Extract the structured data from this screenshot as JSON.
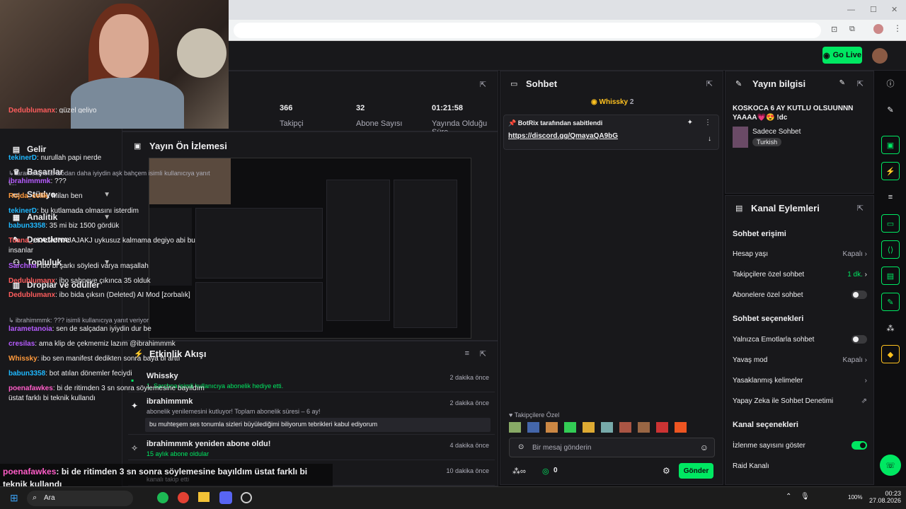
{
  "browser": {
    "search_label": "Ara"
  },
  "header": {
    "go_live": "Go Live"
  },
  "nav": [
    "Gelir",
    "Başarılar",
    "Stüdyo",
    "Analitik",
    "Denetleme",
    "Topluluk",
    "Droplar ve ödüller"
  ],
  "stats": [
    {
      "value": "366",
      "label": "Takipçi"
    },
    {
      "value": "32",
      "label": "Abone Sayısı"
    },
    {
      "value": "01:21:58",
      "label": "Yayında Olduğu Süre"
    }
  ],
  "preview": {
    "title": "Yayın Ön İzlemesi"
  },
  "activity": {
    "title": "Etkinlik Akışı",
    "items": [
      {
        "name": "Whissky",
        "sub": "1, Sarchna isimli kullanıcıya abonelik hediye etti.",
        "time": "2 dakika önce"
      },
      {
        "name": "ibrahimmmk",
        "sub": "abonelik yenilemesini kutluyor! Toplam abonelik süresi – 6 ay!",
        "quote": "bu muhteşem ses tonumla sizleri büyülediğimi biliyorum tebrikleri kabul ediyorum",
        "time": "2 dakika önce"
      },
      {
        "name": "ibrahimmmk yeniden abone oldu!",
        "sub": "15 aylık abone oldular",
        "time": "4 dakika önce"
      },
      {
        "name": "",
        "sub": "kanalı takip etti",
        "time": "10 dakika önce"
      }
    ]
  },
  "chat": {
    "title": "Sohbet",
    "top_user": "Whissky",
    "top_count": "2",
    "pinned_by": "BotRix tarafından sabitlendi",
    "pinned_link": "https://discord.gg/QmayaQA9bG",
    "messages": [
      {
        "user": "Dedublumanx",
        "text": ": güzel geliyo",
        "color": "#ff5d5d"
      },
      {
        "user": "tekinerD",
        "text": ": nurullah papi nerde",
        "color": "#1fb8ff"
      },
      {
        "user": "",
        "text": "↳ larametanoia: ibodan daha iyiydin aşk bahçem isimli kullanıcıya yanıt v...",
        "color": "#adadb8",
        "reply": true
      },
      {
        "user": "ibrahimmmk",
        "text": ": ???",
        "color": "#b65cff"
      },
      {
        "user": "Rojda_celik",
        "text": ": Milan ben",
        "color": "#ff9a3c"
      },
      {
        "user": "tekinerD",
        "text": ": bu kutlamada olmasını isterdim",
        "color": "#1fb8ff"
      },
      {
        "user": "babun3358",
        "text": ": 35 mi biz 1500 gördük",
        "color": "#1fb8ff"
      },
      {
        "user": "Tuana_",
        "text": ": KAJAJNAJAJAKJ uykusuz kalmama degiyo abi bu insanlar",
        "color": "#ff5d5d"
      },
      {
        "user": "Sarchna",
        "text": ": İbo bi şarkı söyledi varya maşallah",
        "color": "#b65cff"
      },
      {
        "user": "Dedublumanx",
        "text": ": ibo sahneye çıkınca 35 olduk",
        "color": "#ff5d5d"
      },
      {
        "user": "Dedublumanx",
        "text": ": ibo bida çıksın (Deleted) AI Mod [zorbalık]",
        "color": "#ff5d5d"
      },
      {
        "user": "",
        "text": "↳ ibrahimmmk: ??? isimli kullanıcıya yanıt veriyor",
        "color": "#adadb8",
        "reply": true
      },
      {
        "user": "larametanoia",
        "text": ": sen de salçadan iyiydin dur be",
        "color": "#b65cff"
      },
      {
        "user": "cresilas",
        "text": ": ama klip de çekmemiz lazım @ibrahimmmk",
        "color": "#b65cff"
      },
      {
        "user": "Whissky",
        "text": ": ibo sen manifest dedikten sonra baya bi arttı",
        "color": "#ff9a3c"
      },
      {
        "user": "babun3358",
        "text": ": bot atılan dönemler feciydi",
        "color": "#1fb8ff"
      },
      {
        "user": "poenafawkes",
        "text": ": bi de ritimden 3 sn sonra söylemesine bayıldım üstat farklı bi teknik kullandı",
        "color": "#ff5dc8"
      }
    ],
    "followers_only": "Takipçilere Özel",
    "placeholder": "Bir mesaj gönderin",
    "points": "0",
    "send": "Gönder"
  },
  "yayin": {
    "title": "Yayın bilgisi",
    "stream_title": "KOSKOCA 6 AY KUTLU OLSUUNNN YAAAA💗😍 !dc",
    "category": "Sadece Sohbet",
    "language": "Turkish"
  },
  "kanal": {
    "title": "Kanal Eylemleri",
    "chat_access": "Sohbet erişimi",
    "account_age": "Hesap yaşı",
    "account_age_val": "Kapalı",
    "followers_chat": "Takipçilere özel sohbet",
    "followers_chat_val": "1 dk.",
    "subs_chat": "Abonelere özel sohbet",
    "chat_options": "Sohbet seçenekleri",
    "emote_only": "Yalnızca Emotlarla sohbet",
    "slow_mode": "Yavaş mod",
    "slow_mode_val": "Kapalı",
    "banned_words": "Yasaklanmış kelimeler",
    "ai_mod": "Yapay Zeka ile Sohbet Denetimi",
    "channel_options": "Kanal seçenekleri",
    "show_views": "İzlenme sayısını göster",
    "raid": "Raid Kanalı"
  },
  "overlay": {
    "user": "poenafawkes",
    "text": ": bi de ritimden 3 sn sonra söylemesine bayıldım üstat farklı bi teknik kullandı"
  },
  "taskbar": {
    "time": "00:23",
    "date": "27.08.2026",
    "battery": "100%"
  }
}
